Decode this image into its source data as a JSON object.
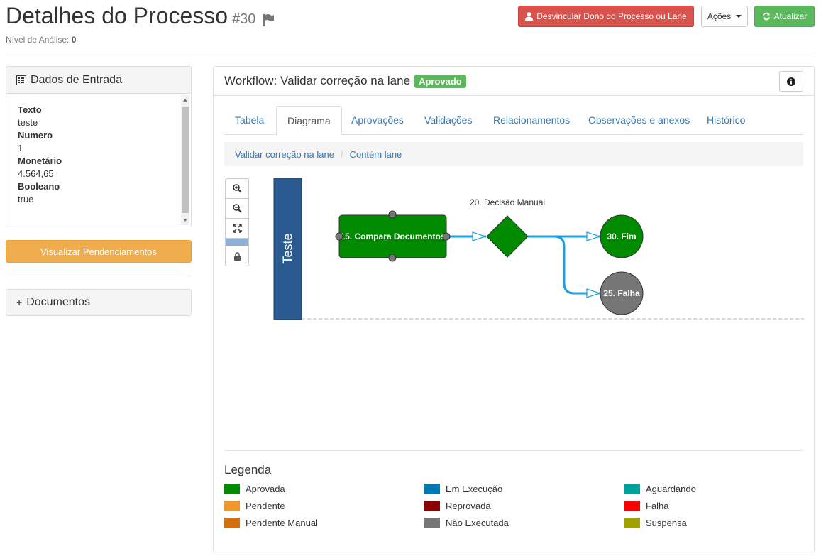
{
  "header": {
    "title": "Detalhes do Processo",
    "number": "#30",
    "analysis_label": "Nível de Análise:",
    "analysis_value": "0",
    "btn_unlink": "Desvincular Dono do Processo ou Lane",
    "btn_actions": "Ações",
    "btn_refresh": "Atualizar"
  },
  "entrada": {
    "title": "Dados de Entrada",
    "fields": [
      {
        "key": "Texto",
        "value": "teste"
      },
      {
        "key": "Numero",
        "value": "1"
      },
      {
        "key": "Monetário",
        "value": "4.564,65"
      },
      {
        "key": "Booleano",
        "value": "true"
      }
    ]
  },
  "pendencias_button": "Visualizar Pendenciamentos",
  "documentos": {
    "title": "Documentos"
  },
  "workflow": {
    "title": "Workflow: Validar correção na lane",
    "status": "Aprovado",
    "tabs": [
      "Tabela",
      "Diagrama",
      "Aprovações",
      "Validações",
      "Relacionamentos",
      "Observações e anexos",
      "Histórico"
    ],
    "active_tab": "Diagrama",
    "breadcrumb": [
      "Validar correção na lane",
      "Contém lane"
    ]
  },
  "diagram": {
    "lane": "Teste",
    "nodes": {
      "task": "15. Compara Documentos",
      "decision": "20. Decisão Manual",
      "end_ok": "30. Fim",
      "end_fail": "25. Falha"
    },
    "colors": {
      "approved": "#008a00",
      "not_executed": "#767676",
      "lane": "#2b5a91",
      "edge": "#1ba1e2"
    }
  },
  "legend": {
    "title": "Legenda",
    "items": [
      {
        "label": "Aprovada",
        "color": "#008a00"
      },
      {
        "label": "Pendente",
        "color": "#f0962a"
      },
      {
        "label": "Pendente Manual",
        "color": "#d36e0f"
      },
      {
        "label": "Em Execução",
        "color": "#0078b4"
      },
      {
        "label": "Reprovada",
        "color": "#8b0000"
      },
      {
        "label": "Não Executada",
        "color": "#767676"
      },
      {
        "label": "Aguardando",
        "color": "#00a09a"
      },
      {
        "label": "Falha",
        "color": "#ff0000"
      },
      {
        "label": "Suspensa",
        "color": "#a0a000"
      }
    ]
  }
}
